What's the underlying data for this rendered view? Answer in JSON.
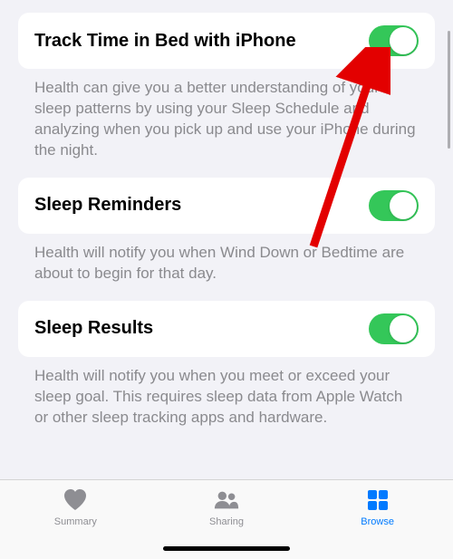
{
  "sections": [
    {
      "title": "Track Time in Bed with iPhone",
      "description": "Health can give you a better understanding of your sleep patterns by using your Sleep Schedule and analyzing when you pick up and use your iPhone during the night."
    },
    {
      "title": "Sleep Reminders",
      "description": "Health will notify you when Wind Down or Bedtime are about to begin for that day."
    },
    {
      "title": "Sleep Results",
      "description": "Health will notify you when you meet or exceed your sleep goal. This requires sleep data from Apple Watch or other sleep tracking apps and hardware."
    }
  ],
  "tabs": {
    "summary": "Summary",
    "sharing": "Sharing",
    "browse": "Browse"
  }
}
